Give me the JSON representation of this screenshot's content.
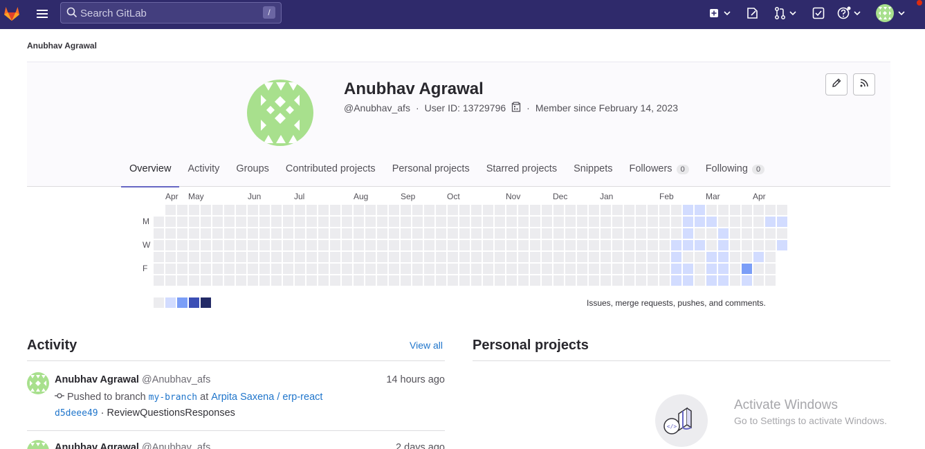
{
  "topbar": {
    "search_placeholder": "Search GitLab",
    "search_shortcut": "/",
    "icons": [
      "gitlab-logo-icon",
      "hamburger-menu-icon",
      "plus-square-icon",
      "issues-icon",
      "merge-request-icon",
      "todo-icon",
      "help-icon",
      "user-avatar"
    ]
  },
  "breadcrumb": "Anubhav Agrawal",
  "profile": {
    "name": "Anubhav Agrawal",
    "username": "@Anubhav_afs",
    "user_id": "User ID: 13729796",
    "member_since": "Member since February 14, 2023",
    "edit_icon": "pencil-icon",
    "rss_icon": "rss-icon"
  },
  "tabs": [
    {
      "label": "Overview",
      "active": true
    },
    {
      "label": "Activity"
    },
    {
      "label": "Groups"
    },
    {
      "label": "Contributed projects"
    },
    {
      "label": "Personal projects"
    },
    {
      "label": "Starred projects"
    },
    {
      "label": "Snippets"
    },
    {
      "label": "Followers",
      "count": "0"
    },
    {
      "label": "Following",
      "count": "0"
    }
  ],
  "calendar": {
    "months": [
      "Apr",
      "May",
      "Jun",
      "Jul",
      "Aug",
      "Sep",
      "Oct",
      "Nov",
      "Dec",
      "Jan",
      "Feb",
      "Mar",
      "Apr"
    ],
    "days": [
      "M",
      "W",
      "F"
    ],
    "note": "Issues, merge requests, pushes, and comments.",
    "colors": [
      "#ececef",
      "#d2dcff",
      "#7b9ef7",
      "#3b4fb5",
      "#222a66"
    ]
  },
  "activity": {
    "title": "Activity",
    "view_all": "View all",
    "events": [
      {
        "name": "Anubhav Agrawal",
        "username": "@Anubhav_afs",
        "time": "14 hours ago",
        "action": "Pushed to branch",
        "branch": "my-branch",
        "at": "at",
        "project": "Arpita Saxena / erp-react",
        "commit": "d5deee49",
        "commit_sep": "·",
        "commit_msg": "ReviewQuestionsResponses"
      },
      {
        "name": "Anubhav Agrawal",
        "username": "@Anubhav_afs",
        "time": "2 days ago"
      }
    ]
  },
  "personal_projects": {
    "title": "Personal projects"
  },
  "watermark": {
    "line1": "Activate Windows",
    "line2": "Go to Settings to activate Windows."
  }
}
